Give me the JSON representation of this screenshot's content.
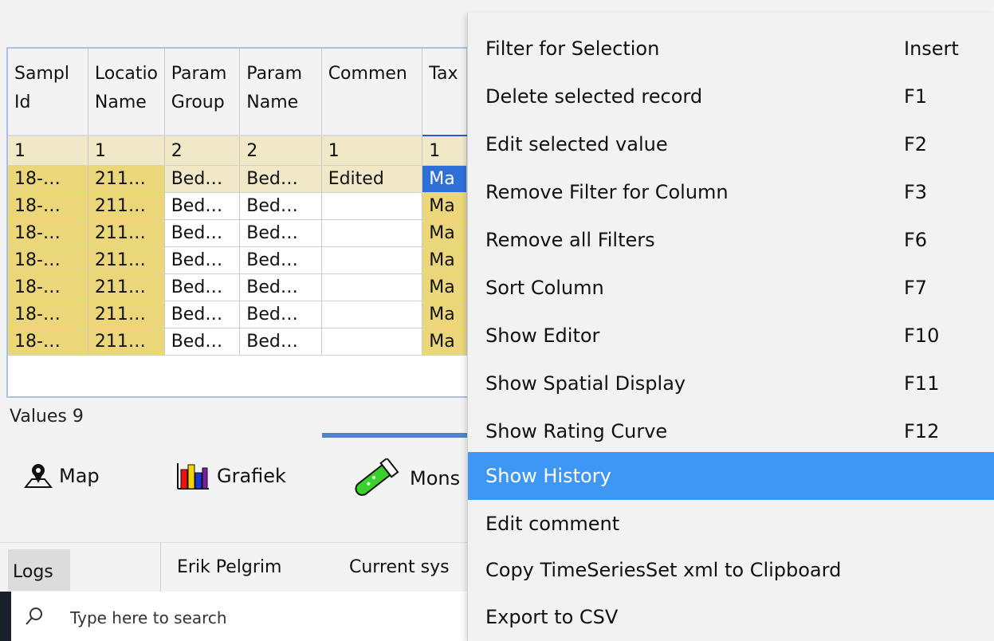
{
  "table": {
    "columns": [
      {
        "line1": "Sampl",
        "line2": "Id"
      },
      {
        "line1": "Locatio",
        "line2": "Name"
      },
      {
        "line1": "Param",
        "line2": "Group"
      },
      {
        "line1": "Param",
        "line2": "Name"
      },
      {
        "line1": "Commen",
        "line2": ""
      },
      {
        "line1": "Tax",
        "line2": ""
      }
    ],
    "counts": [
      "1",
      "1",
      "2",
      "2",
      "1",
      "1"
    ],
    "rows": [
      [
        "18-…",
        "211…",
        "Bed…",
        "Bed…",
        "Edited",
        "Ma"
      ],
      [
        "18-…",
        "211…",
        "Bed…",
        "Bed…",
        "",
        "Ma"
      ],
      [
        "18-…",
        "211…",
        "Bed…",
        "Bed…",
        "",
        "Ma"
      ],
      [
        "18-…",
        "211…",
        "Bed…",
        "Bed…",
        "",
        "Ma"
      ],
      [
        "18-…",
        "211…",
        "Bed…",
        "Bed…",
        "",
        "Ma"
      ],
      [
        "18-…",
        "211…",
        "Bed…",
        "Bed…",
        "",
        "Ma"
      ],
      [
        "18-…",
        "211…",
        "Bed…",
        "Bed…",
        "",
        "Ma"
      ]
    ]
  },
  "values_label": "Values 9",
  "toolbar": {
    "map": "Map",
    "grafiek": "Grafiek",
    "monster": "Mons"
  },
  "statusbar": {
    "logs": "Logs",
    "user": "Erik Pelgrim",
    "current": "Current sys"
  },
  "taskbar": {
    "search_placeholder": "Type here to search"
  },
  "context_menu": {
    "items": [
      {
        "label": "Filter for Selection",
        "shortcut": "Insert"
      },
      {
        "label": "Delete selected record",
        "shortcut": "F1"
      },
      {
        "label": "Edit selected value",
        "shortcut": "F2"
      },
      {
        "label": "Remove Filter for Column",
        "shortcut": "F3"
      },
      {
        "label": "Remove all Filters",
        "shortcut": "F6"
      },
      {
        "label": "Sort Column",
        "shortcut": "F7"
      },
      {
        "label": "Show Editor",
        "shortcut": "F10"
      },
      {
        "label": "Show Spatial Display",
        "shortcut": "F11"
      },
      {
        "label": "Show Rating Curve",
        "shortcut": "F12"
      },
      {
        "label": "Show History",
        "shortcut": ""
      },
      {
        "label": "Edit comment",
        "shortcut": ""
      },
      {
        "label": "Copy TimeSeriesSet xml to Clipboard",
        "shortcut": ""
      },
      {
        "label": "Export to CSV",
        "shortcut": ""
      }
    ],
    "highlighted_index": 9,
    "highlight_color": "#3f97f5"
  }
}
